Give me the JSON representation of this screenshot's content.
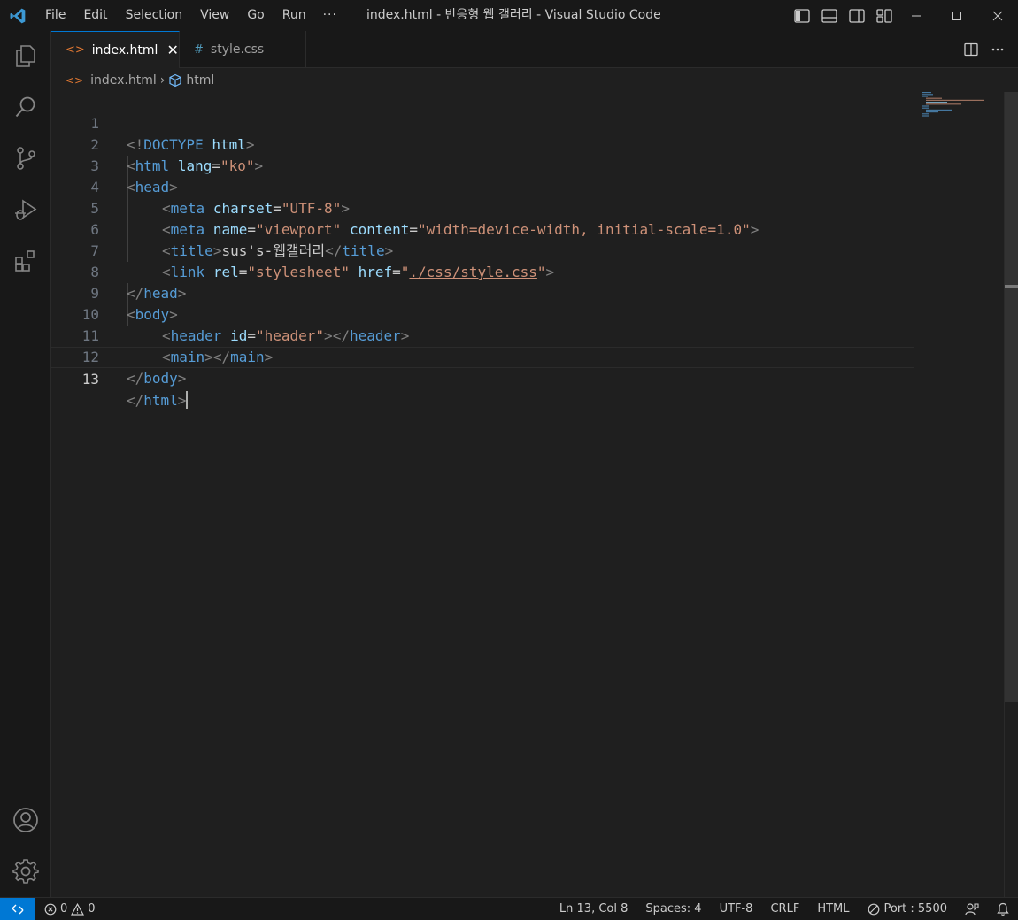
{
  "menu": {
    "file": "File",
    "edit": "Edit",
    "selection": "Selection",
    "view": "View",
    "go": "Go",
    "run": "Run",
    "more": "···"
  },
  "window_title": "index.html - 반응형 웹 갤러리 - Visual Studio Code",
  "tabs": [
    {
      "label": "index.html",
      "icon": "html-file-icon",
      "close": "✕"
    },
    {
      "label": "style.css",
      "icon": "#"
    }
  ],
  "breadcrumb": {
    "file": "index.html",
    "separator": "›",
    "symbol": "html"
  },
  "editor": {
    "line_numbers": [
      "1",
      "2",
      "3",
      "4",
      "5",
      "6",
      "7",
      "8",
      "9",
      "10",
      "11",
      "12",
      "13"
    ],
    "lines": {
      "l1": {
        "b1": "<!",
        "tag": "DOCTYPE",
        "sp": " ",
        "attr": "html",
        "b2": ">"
      },
      "l2": {
        "b1": "<",
        "tag": "html",
        "sp": " ",
        "attr": "lang",
        "eq": "=",
        "val": "\"ko\"",
        "b2": ">"
      },
      "l3": {
        "b1": "<",
        "tag": "head",
        "b2": ">"
      },
      "l4": {
        "b1": "<",
        "tag": "meta",
        "sp": " ",
        "attr": "charset",
        "eq": "=",
        "val": "\"UTF-8\"",
        "b2": ">"
      },
      "l5": {
        "b1": "<",
        "tag": "meta",
        "sp": " ",
        "attr1": "name",
        "eq1": "=",
        "val1": "\"viewport\"",
        "sp2": " ",
        "attr2": "content",
        "eq2": "=",
        "val2": "\"width=device-width, initial-scale=1.0\"",
        "b2": ">"
      },
      "l6": {
        "b1": "<",
        "tag": "title",
        "b2": ">",
        "text": "sus's-웹갤러리",
        "b3": "</",
        "tag2": "title",
        "b4": ">"
      },
      "l7": {
        "b1": "<",
        "tag": "link",
        "sp": " ",
        "attr1": "rel",
        "eq1": "=",
        "val1": "\"stylesheet\"",
        "sp2": " ",
        "attr2": "href",
        "eq2": "=",
        "q1": "\"",
        "link": "./css/style.css",
        "q2": "\"",
        "b2": ">"
      },
      "l8": {
        "b1": "</",
        "tag": "head",
        "b2": ">"
      },
      "l9": {
        "b1": "<",
        "tag": "body",
        "b2": ">"
      },
      "l10": {
        "b1": "<",
        "tag": "header",
        "sp": " ",
        "attr": "id",
        "eq": "=",
        "val": "\"header\"",
        "b2": ">",
        "b3": "</",
        "tag2": "header",
        "b4": ">"
      },
      "l11": {
        "b1": "<",
        "tag": "main",
        "b2": ">",
        "b3": "</",
        "tag2": "main",
        "b4": ">"
      },
      "l12": {
        "b1": "</",
        "tag": "body",
        "b2": ">"
      },
      "l13": {
        "b1": "</",
        "tag": "html",
        "b2": ">"
      }
    }
  },
  "status": {
    "errors": "0",
    "warnings": "0",
    "position": "Ln 13, Col 8",
    "spaces": "Spaces: 4",
    "encoding": "UTF-8",
    "eol": "CRLF",
    "language": "HTML",
    "port": "Port : 5500"
  },
  "colors": {
    "accent": "#0078d4",
    "tag": "#569cd6",
    "attr": "#9cdcfe",
    "string": "#ce9178",
    "bracket": "#808080"
  }
}
